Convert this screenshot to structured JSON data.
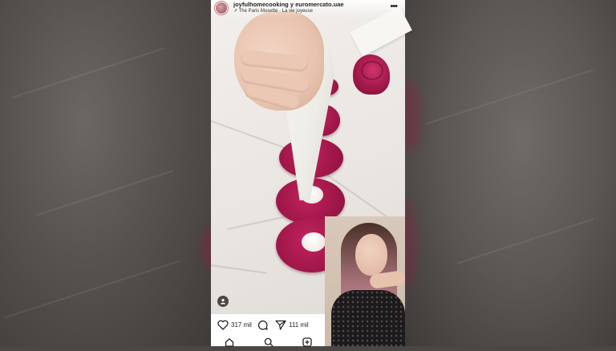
{
  "post": {
    "account": "joyfulhomecooking y euromercato.uae",
    "audio_track": "The Paris Musette · La vie joyeuse"
  },
  "actions": {
    "likes": "317 mil",
    "shares": "111 mil"
  },
  "icons": {
    "more": "more-dots-icon",
    "audio": "audio-arrow-icon",
    "like": "heart-icon",
    "comment": "comment-icon",
    "share": "send-icon",
    "home": "home-icon",
    "search": "search-icon",
    "create": "create-icon",
    "profile": "profile-icon"
  },
  "colors": {
    "disc": "#a3184a",
    "bar_bg": "#ffffff",
    "text": "#222222"
  }
}
